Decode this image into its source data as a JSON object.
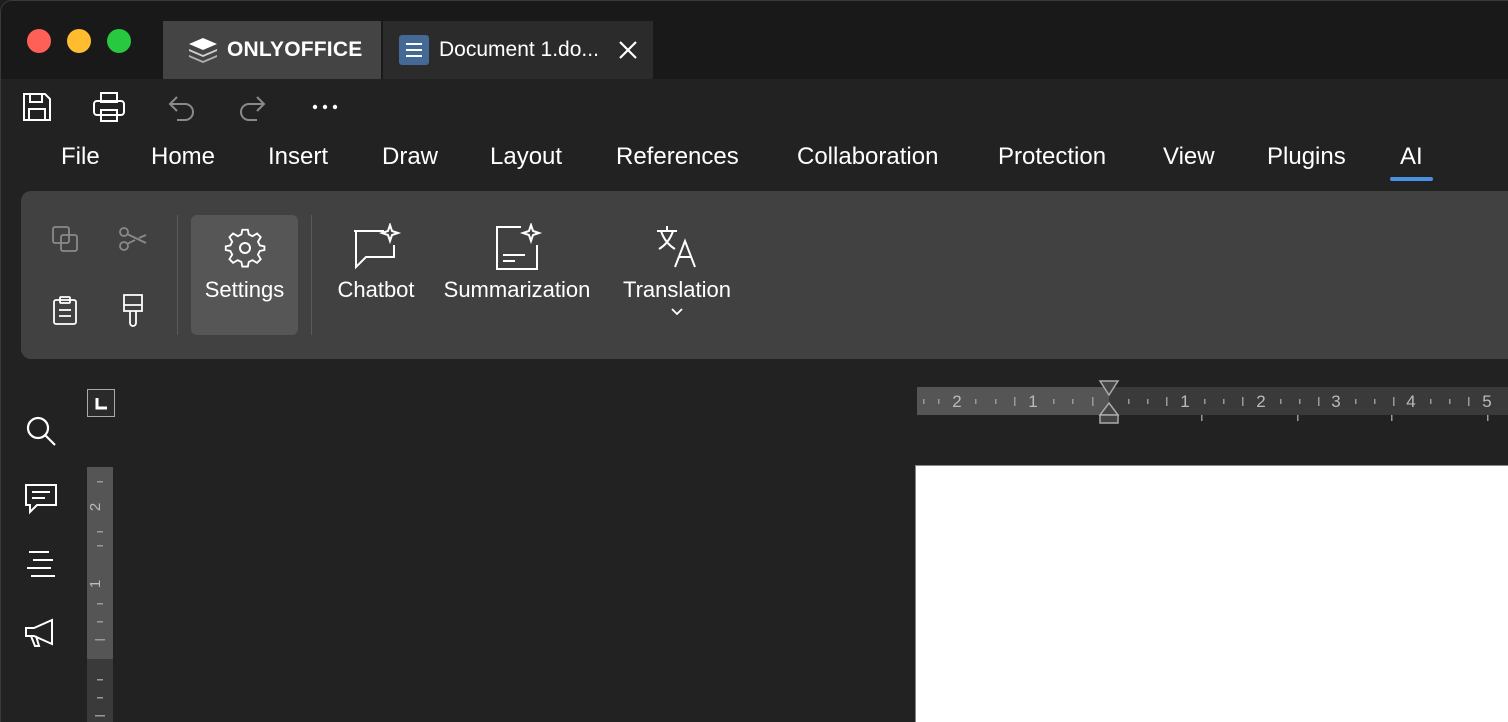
{
  "window": {
    "brand_tab": {
      "label": "ONLYOFFICE"
    },
    "doc_tab": {
      "title": "Document 1.do..."
    }
  },
  "quick_access": {
    "icons": [
      "save-icon",
      "print-icon",
      "undo-icon",
      "redo-icon",
      "more-icon"
    ]
  },
  "menu": {
    "items": [
      "File",
      "Home",
      "Insert",
      "Draw",
      "Layout",
      "References",
      "Collaboration",
      "Protection",
      "View",
      "Plugins",
      "AI"
    ],
    "active": "AI"
  },
  "toolbar": {
    "settings_label": "Settings",
    "chatbot_label": "Chatbot",
    "summarization_label": "Summarization",
    "translation_label": "Translation"
  },
  "rulers": {
    "horizontal_labels": [
      "2",
      "1",
      "1",
      "2",
      "3",
      "4",
      "5"
    ],
    "vertical_labels": [
      "2",
      "1"
    ]
  },
  "colors": {
    "accent": "#4a90e2",
    "close_red": "#fe5f57",
    "minimize_yellow": "#febc2e",
    "zoom_green": "#28c840",
    "doc_icon": "#446995"
  }
}
